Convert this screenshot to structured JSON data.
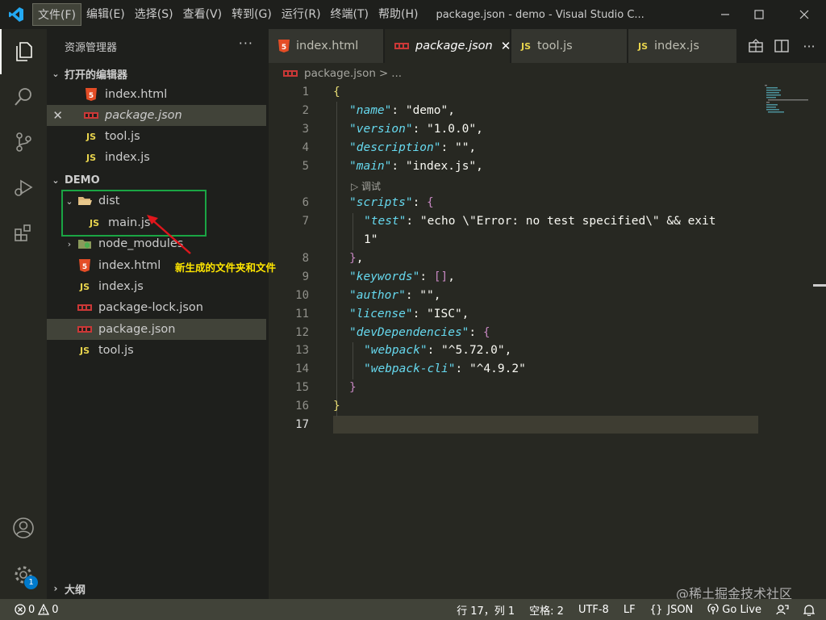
{
  "titlebar": {
    "menu": [
      "文件(F)",
      "编辑(E)",
      "选择(S)",
      "查看(V)",
      "转到(G)",
      "运行(R)",
      "终端(T)",
      "帮助(H)"
    ],
    "window_title": "package.json - demo - Visual Studio C..."
  },
  "sidebar": {
    "title": "资源管理器",
    "open_editors_label": "打开的编辑器",
    "open_editors": [
      {
        "name": "index.html",
        "icon": "html5-icon"
      },
      {
        "name": "package.json",
        "icon": "npm-icon"
      },
      {
        "name": "tool.js",
        "icon": "js-icon"
      },
      {
        "name": "index.js",
        "icon": "js-icon"
      }
    ],
    "folder_label": "DEMO",
    "tree": [
      {
        "name": "dist",
        "icon": "folder-open-icon"
      },
      {
        "name": "main.js",
        "icon": "js-icon"
      },
      {
        "name": "node_modules",
        "icon": "folder-node-icon"
      },
      {
        "name": "index.html",
        "icon": "html5-icon"
      },
      {
        "name": "index.js",
        "icon": "js-icon"
      },
      {
        "name": "package-lock.json",
        "icon": "npm-icon"
      },
      {
        "name": "package.json",
        "icon": "npm-icon"
      },
      {
        "name": "tool.js",
        "icon": "js-icon"
      }
    ],
    "annotation": "新生成的文件夹和文件",
    "outline_label": "大纲"
  },
  "tabs": [
    {
      "label": "index.html",
      "icon": "html5-icon"
    },
    {
      "label": "package.json",
      "icon": "npm-icon",
      "active": true
    },
    {
      "label": "tool.js",
      "icon": "js-icon"
    },
    {
      "label": "index.js",
      "icon": "js-icon"
    }
  ],
  "breadcrumb": {
    "file": "package.json",
    "sep": ">",
    "more": "..."
  },
  "editor": {
    "codelens": "调试",
    "line_numbers": [
      "1",
      "2",
      "3",
      "4",
      "5",
      "6",
      "7",
      "",
      "8",
      "9",
      "10",
      "11",
      "12",
      "13",
      "14",
      "15",
      "16",
      "17"
    ],
    "lines": {
      "l1": "{",
      "k_name": "\"name\"",
      "v_name": ": \"demo\",",
      "k_version": "\"version\"",
      "v_version": ": \"1.0.0\",",
      "k_description": "\"description\"",
      "v_description": ": \"\",",
      "k_main": "\"main\"",
      "v_main": ": \"index.js\",",
      "k_scripts": "\"scripts\"",
      "v_scripts_colon": ": ",
      "v_scripts_brace": "{",
      "k_test": "\"test\"",
      "v_test": ": \"echo \\\"Error: no test specified\\\" && exit",
      "v_test_cont": "1\"",
      "l8_brace": "}",
      "l8_comma": ",",
      "k_keywords": "\"keywords\"",
      "v_keywords_colon": ": ",
      "v_keywords_br": "[]",
      "v_keywords_comma": ",",
      "k_author": "\"author\"",
      "v_author": ": \"\",",
      "k_license": "\"license\"",
      "v_license": ": \"ISC\",",
      "k_devdeps": "\"devDependencies\"",
      "v_devdeps_colon": ": ",
      "v_devdeps_brace": "{",
      "k_webpack": "\"webpack\"",
      "v_webpack": ": \"^5.72.0\",",
      "k_webpackcli": "\"webpack-cli\"",
      "v_webpackcli": ": \"^4.9.2\"",
      "l15": "}",
      "l16": "}"
    }
  },
  "status": {
    "errors": "0",
    "warnings": "0",
    "position": "行 17，列 1",
    "spaces": "空格: 2",
    "encoding": "UTF-8",
    "eol": "LF",
    "language": "JSON",
    "golive": "Go Live"
  },
  "badge": "1",
  "watermark": "@稀土掘金技术社区",
  "colors": {
    "accent": "#1aa544",
    "annotation_text": "#ffe600",
    "badge": "#007acc"
  }
}
